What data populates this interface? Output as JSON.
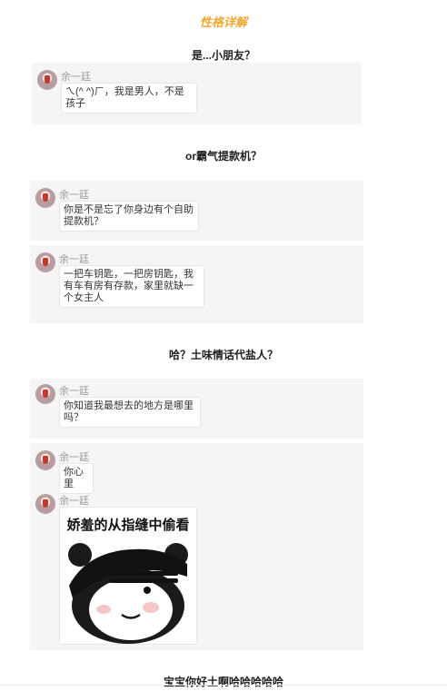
{
  "page_title": "性格详解",
  "sender_name": "余一廷",
  "sections": [
    {
      "heading": "是...小朋友？",
      "messages": [
        "ㄟ(^ ^)ㄏ，我是男人，不是孩子"
      ]
    },
    {
      "heading": "or霸气提款机？",
      "messages": [
        "你是不是忘了你身边有个自助提款机？",
        "一把车钥匙，一把房钥匙，我有车有房有存款，家里就缺一个女主人"
      ]
    },
    {
      "heading": "哈？土味情话代盐人？",
      "messages": [
        "你知道我最想去的地方是哪里吗？",
        "你心里"
      ],
      "sticker": {
        "caption": "娇羞的从指缝中偷看",
        "icon": "panda-peeking-through-fingers-icon"
      }
    },
    {
      "heading": "宝宝你好土啊哈哈哈哈哈"
    }
  ],
  "colors": {
    "title": "#f0a830",
    "card_background": "#f5f5f5",
    "bubble_background": "#ffffff"
  }
}
